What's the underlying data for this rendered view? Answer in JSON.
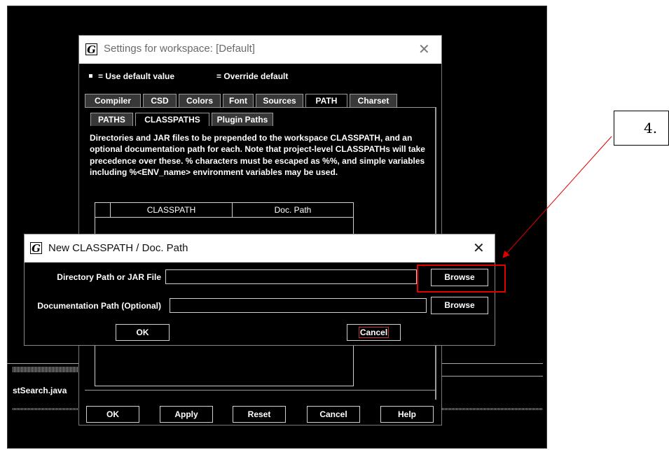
{
  "settings": {
    "title": "Settings for workspace: [Default]",
    "legend_default": "= Use default value",
    "legend_override": "= Override default",
    "tabs": [
      "Compiler",
      "CSD",
      "Colors",
      "Font",
      "Sources",
      "PATH",
      "Charset"
    ],
    "active_tab": "PATH",
    "subtabs": [
      "PATHS",
      "CLASSPATHS",
      "Plugin Paths"
    ],
    "active_subtab": "CLASSPATHS",
    "description": "Directories and JAR files to be prepended to the workspace CLASSPATH, and an optional documentation path for each. Note that project-level CLASSPATHs will take precedence over these. % characters must be escaped as %%, and simple variables including %<ENV_name> environment variables may be used.",
    "table_headers": [
      "CLASSPATH",
      "Doc. Path"
    ],
    "buttons": {
      "ok": "OK",
      "apply": "Apply",
      "reset": "Reset",
      "cancel": "Cancel",
      "help": "Help"
    }
  },
  "background": {
    "file_label": "stSearch.java"
  },
  "dialog": {
    "title": "New CLASSPATH / Doc. Path",
    "dir_label": "Directory Path or JAR File",
    "dir_value": "",
    "doc_label": "Documentation Path (Optional)",
    "doc_value": "",
    "browse1": "Browse",
    "browse2": "Browse",
    "ok": "OK",
    "cancel": "Cancel"
  },
  "annotation": {
    "label": "4.",
    "color": "#e00000"
  },
  "icons": {
    "app_icon": "G",
    "close": "✕"
  }
}
